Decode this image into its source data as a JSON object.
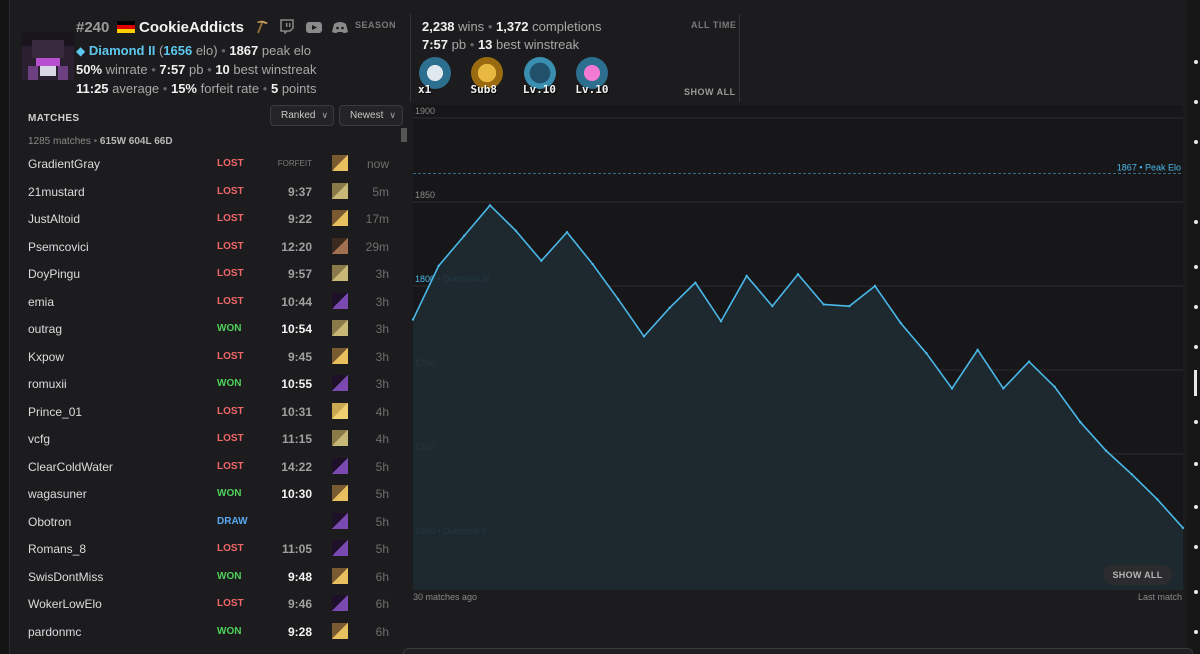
{
  "header": {
    "rank": "#240",
    "username": "CookieAddicts",
    "season_label": "SEASON",
    "tier_name": "Diamond II",
    "elo": "1656",
    "elo_unit": "elo",
    "peak_elo": "1867",
    "peak_elo_label": "peak elo",
    "winrate": "50%",
    "winrate_label": "winrate",
    "pb": "7:57",
    "pb_label": "pb",
    "best_winstreak": "10",
    "best_winstreak_label": "best winstreak",
    "average": "11:25",
    "average_label": "average",
    "forfeit_rate": "15%",
    "forfeit_rate_label": "forfeit rate",
    "points": "5",
    "points_label": "points",
    "flag_colors": [
      "#000000",
      "#dd0000",
      "#ffce00"
    ],
    "social_icons": [
      "pickaxe-icon",
      "twitch-icon",
      "youtube-icon",
      "discord-icon"
    ]
  },
  "alltime": {
    "wins": "2,238",
    "wins_label": "wins",
    "completions": "1,372",
    "completions_label": "completions",
    "pb": "7:57",
    "pb_label": "pb",
    "best_winstreak": "13",
    "best_winstreak_label": "best winstreak",
    "label": "ALL TIME",
    "show_all": "SHOW ALL",
    "badges": [
      {
        "icon": "sword-badge-icon",
        "label": "x1",
        "color": "#3a8fb0"
      },
      {
        "icon": "medal-badge-icon",
        "label": "Sub8",
        "color": "#c89a2a"
      },
      {
        "icon": "pickaxe-badge-icon",
        "label": "Lv.10",
        "color": "#3a8fb0"
      },
      {
        "icon": "gem-badge-icon",
        "label": "Lv.10",
        "color": "#c04aa0"
      }
    ]
  },
  "matches": {
    "title": "MATCHES",
    "filter_ranked": "Ranked",
    "filter_sort": "Newest",
    "summary_count": "1285 matches",
    "summary_record": "615W 604L 66D",
    "rows": [
      {
        "opponent": "GradientGray",
        "result": "LOST",
        "time": "FORFEIT",
        "ago": "now",
        "seed": "village"
      },
      {
        "opponent": "21mustard",
        "result": "LOST",
        "time": "9:37",
        "ago": "5m",
        "seed": "desert"
      },
      {
        "opponent": "JustAltoid",
        "result": "LOST",
        "time": "9:22",
        "ago": "17m",
        "seed": "village"
      },
      {
        "opponent": "Psemcovici",
        "result": "LOST",
        "time": "12:20",
        "ago": "29m",
        "seed": "ship"
      },
      {
        "opponent": "DoyPingu",
        "result": "LOST",
        "time": "9:57",
        "ago": "3h",
        "seed": "desert"
      },
      {
        "opponent": "emia",
        "result": "LOST",
        "time": "10:44",
        "ago": "3h",
        "seed": "portal"
      },
      {
        "opponent": "outrag",
        "result": "WON",
        "time": "10:54",
        "ago": "3h",
        "seed": "desert"
      },
      {
        "opponent": "Kxpow",
        "result": "LOST",
        "time": "9:45",
        "ago": "3h",
        "seed": "village"
      },
      {
        "opponent": "romuxii",
        "result": "WON",
        "time": "10:55",
        "ago": "3h",
        "seed": "portal"
      },
      {
        "opponent": "Prince_01",
        "result": "LOST",
        "time": "10:31",
        "ago": "4h",
        "seed": "temple"
      },
      {
        "opponent": "vcfg",
        "result": "LOST",
        "time": "11:15",
        "ago": "4h",
        "seed": "desert"
      },
      {
        "opponent": "ClearColdWater",
        "result": "LOST",
        "time": "14:22",
        "ago": "5h",
        "seed": "portal"
      },
      {
        "opponent": "wagasuner",
        "result": "WON",
        "time": "10:30",
        "ago": "5h",
        "seed": "village"
      },
      {
        "opponent": "Obotron",
        "result": "DRAW",
        "time": "",
        "ago": "5h",
        "seed": "portal"
      },
      {
        "opponent": "Romans_8",
        "result": "LOST",
        "time": "11:05",
        "ago": "5h",
        "seed": "portal"
      },
      {
        "opponent": "SwisDontMiss",
        "result": "WON",
        "time": "9:48",
        "ago": "6h",
        "seed": "village"
      },
      {
        "opponent": "WokerLowElo",
        "result": "LOST",
        "time": "9:46",
        "ago": "6h",
        "seed": "portal"
      },
      {
        "opponent": "pardonmc",
        "result": "WON",
        "time": "9:28",
        "ago": "6h",
        "seed": "village"
      }
    ]
  },
  "chart_data": {
    "type": "area",
    "title": "",
    "xlabel_left": "30 matches ago",
    "xlabel_right": "Last match",
    "ylim": [
      1600,
      1900
    ],
    "yticks": [
      1900,
      1850,
      1800,
      1750,
      1700,
      1650
    ],
    "y_tick_labels": [
      "1900",
      "1850",
      "1800 • Diamond III",
      "1750",
      "1700",
      "1650 • Diamond II"
    ],
    "peak_line": {
      "value": 1867,
      "label": "1867 • Peak Elo"
    },
    "series": [
      {
        "values": [
          1780,
          1812,
          1830,
          1848,
          1833,
          1815,
          1832,
          1813,
          1792,
          1770,
          1787,
          1802,
          1779,
          1806,
          1788,
          1807,
          1789,
          1788,
          1800,
          1778,
          1760,
          1739,
          1762,
          1739,
          1755,
          1740,
          1719,
          1702,
          1688,
          1673,
          1656
        ]
      }
    ],
    "show_all": "SHOW ALL"
  },
  "colors": {
    "line": "#4ab8e8",
    "area": "#1e2a32",
    "lost": "#f0676a",
    "won": "#4fd05a",
    "draw": "#5aa8f0"
  }
}
